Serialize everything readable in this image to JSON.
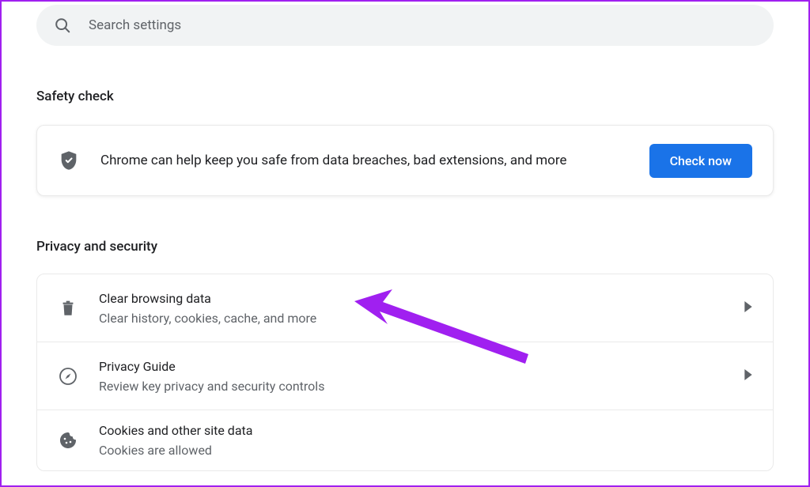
{
  "search": {
    "placeholder": "Search settings"
  },
  "sections": {
    "safety_check_title": "Safety check"
  },
  "safety_card": {
    "text": "Chrome can help keep you safe from data breaches, bad extensions, and more",
    "button_label": "Check now"
  },
  "privacy": {
    "title": "Privacy and security",
    "rows": [
      {
        "title": "Clear browsing data",
        "subtitle": "Clear history, cookies, cache, and more"
      },
      {
        "title": "Privacy Guide",
        "subtitle": "Review key privacy and security controls"
      },
      {
        "title": "Cookies and other site data",
        "subtitle": "Cookies are allowed"
      }
    ]
  }
}
